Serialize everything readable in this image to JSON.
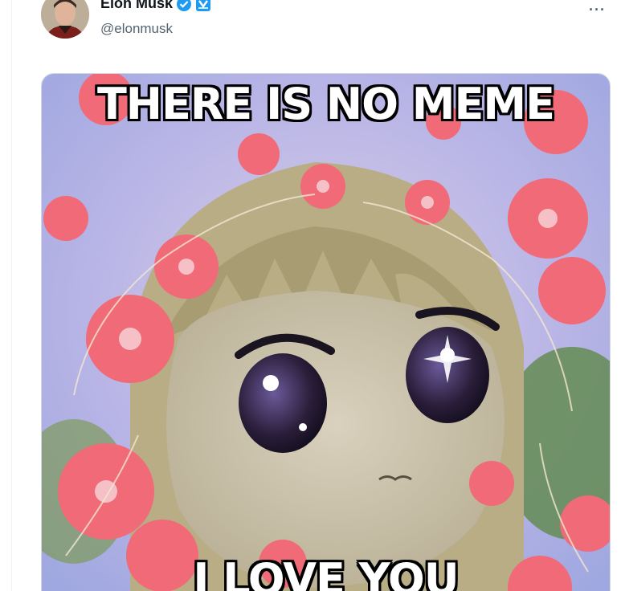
{
  "tweet": {
    "author_name": "Elon Musk",
    "author_handle": "@elonmusk",
    "more_label": "···",
    "verified_icon": "verified-badge-icon",
    "affiliate_icon": "affiliate-badge-icon"
  },
  "media": {
    "top_text": "THERE IS NO MEME",
    "bottom_text": "I LOVE YOU"
  },
  "colors": {
    "verified_blue": "#1d9bf0",
    "handle_gray": "#536471",
    "name_black": "#0f1419"
  }
}
